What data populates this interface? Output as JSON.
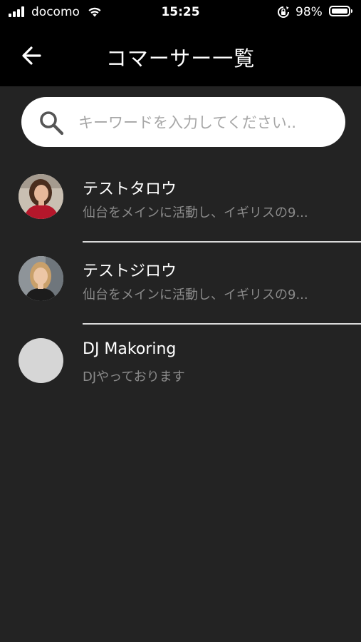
{
  "status_bar": {
    "carrier": "docomo",
    "time": "15:25",
    "battery_percent": "98%",
    "battery_level": 0.98
  },
  "header": {
    "title": "コマーサー一覧",
    "back_icon": "arrow-left-icon"
  },
  "search": {
    "placeholder": "キーワードを入力してください..",
    "value": "",
    "icon": "search-icon"
  },
  "commercers": [
    {
      "name": "テストタロウ",
      "description": "仙台をメインに活動し、イギリスの9...",
      "avatar": "photo-woman-red-top"
    },
    {
      "name": "テストジロウ",
      "description": "仙台をメインに活動し、イギリスの9...",
      "avatar": "photo-woman-black-top"
    },
    {
      "name": "DJ Makoring",
      "description": "DJやっております",
      "avatar": "placeholder"
    }
  ],
  "colors": {
    "background": "#232323",
    "header": "#000000",
    "search_bg": "#ffffff",
    "secondary_text": "#8a8a8a",
    "divider": "#d9d9d9",
    "avatar_placeholder": "#d6d6d6"
  }
}
